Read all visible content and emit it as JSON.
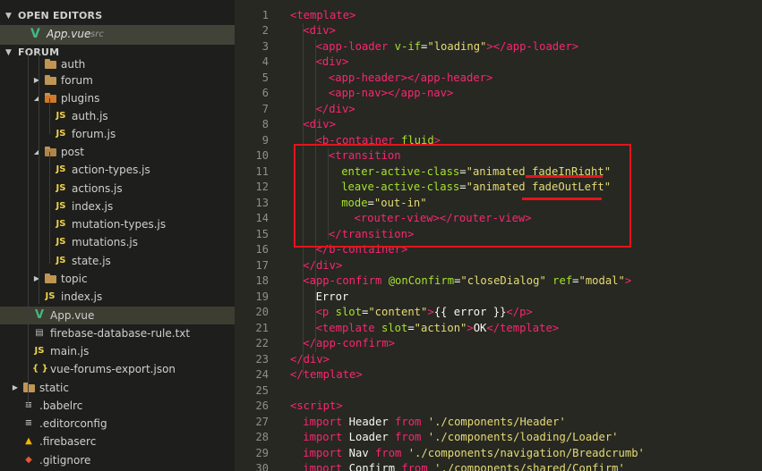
{
  "sidebar": {
    "open_editors_header": "OPEN EDITORS",
    "open_editor": {
      "name": "App.vue",
      "desc": "src"
    },
    "project_header": "FORUM",
    "tree": [
      {
        "label": "auth",
        "type": "folder"
      },
      {
        "label": "forum",
        "type": "folder"
      },
      {
        "label": "plugins",
        "type": "folder"
      },
      {
        "label": "auth.js",
        "type": "js"
      },
      {
        "label": "forum.js",
        "type": "js"
      },
      {
        "label": "post",
        "type": "folder"
      },
      {
        "label": "action-types.js",
        "type": "js"
      },
      {
        "label": "actions.js",
        "type": "js"
      },
      {
        "label": "index.js",
        "type": "js"
      },
      {
        "label": "mutation-types.js",
        "type": "js"
      },
      {
        "label": "mutations.js",
        "type": "js"
      },
      {
        "label": "state.js",
        "type": "js"
      },
      {
        "label": "topic",
        "type": "folder"
      },
      {
        "label": "index.js",
        "type": "js"
      },
      {
        "label": "App.vue",
        "type": "vue"
      },
      {
        "label": "firebase-database-rule.txt",
        "type": "txt"
      },
      {
        "label": "main.js",
        "type": "js"
      },
      {
        "label": "vue-forums-export.json",
        "type": "json"
      },
      {
        "label": "static",
        "type": "folder"
      },
      {
        "label": ".babelrc",
        "type": "cfg"
      },
      {
        "label": ".editorconfig",
        "type": "cfg"
      },
      {
        "label": ".firebaserc",
        "type": "firebase"
      },
      {
        "label": ".gitignore",
        "type": "git"
      }
    ],
    "icons": {
      "js": "JS",
      "json": "{ }",
      "vue": "V"
    }
  },
  "editor": {
    "line_numbers": [
      "1",
      "2",
      "3",
      "4",
      "5",
      "6",
      "7",
      "8",
      "9",
      "10",
      "11",
      "12",
      "13",
      "14",
      "15",
      "16",
      "17",
      "18",
      "19",
      "20",
      "21",
      "22",
      "23",
      "24",
      "25",
      "26",
      "27",
      "28",
      "29",
      "30"
    ],
    "lines": [
      [
        [
          "tag",
          "<template>"
        ]
      ],
      [
        [
          "tag",
          "<div>"
        ]
      ],
      [
        [
          "tag",
          "<app-loader "
        ],
        [
          "attr",
          "v-if"
        ],
        [
          "txt",
          "="
        ],
        [
          "str",
          "\"loading\""
        ],
        [
          "tag",
          "></app-loader>"
        ]
      ],
      [
        [
          "tag",
          "<div>"
        ]
      ],
      [
        [
          "tag",
          "<app-header></app-header>"
        ]
      ],
      [
        [
          "tag",
          "<app-nav></app-nav>"
        ]
      ],
      [
        [
          "tag",
          "</div>"
        ]
      ],
      [
        [
          "tag",
          "<div>"
        ]
      ],
      [
        [
          "tag",
          "<b-container "
        ],
        [
          "attr",
          "fluid"
        ],
        [
          "tag",
          ">"
        ]
      ],
      [
        [
          "tag",
          "<transition"
        ]
      ],
      [
        [
          "attr",
          "enter-active-class"
        ],
        [
          "txt",
          "="
        ],
        [
          "str",
          "\"animated fadeInRight\""
        ]
      ],
      [
        [
          "attr",
          "leave-active-class"
        ],
        [
          "txt",
          "="
        ],
        [
          "str",
          "\"animated fadeOutLeft\""
        ]
      ],
      [
        [
          "attr",
          "mode"
        ],
        [
          "txt",
          "="
        ],
        [
          "str",
          "\"out-in\""
        ]
      ],
      [
        [
          "tag",
          "<router-view></router-view>"
        ]
      ],
      [
        [
          "tag",
          "</transition>"
        ]
      ],
      [
        [
          "tag",
          "</b-container>"
        ]
      ],
      [
        [
          "tag",
          "</div>"
        ]
      ],
      [
        [
          "tag",
          "<app-confirm "
        ],
        [
          "attr",
          "@onConfirm"
        ],
        [
          "txt",
          "="
        ],
        [
          "str",
          "\"closeDialog\""
        ],
        [
          "txt",
          " "
        ],
        [
          "attr",
          "ref"
        ],
        [
          "txt",
          "="
        ],
        [
          "str",
          "\"modal\""
        ],
        [
          "tag",
          ">"
        ]
      ],
      [
        [
          "txt",
          "Error"
        ]
      ],
      [
        [
          "tag",
          "<p "
        ],
        [
          "attr",
          "slot"
        ],
        [
          "txt",
          "="
        ],
        [
          "str",
          "\"content\""
        ],
        [
          "tag",
          ">"
        ],
        [
          "txt",
          "{{ error }}"
        ],
        [
          "tag",
          "</p>"
        ]
      ],
      [
        [
          "tag",
          "<template "
        ],
        [
          "attr",
          "slot"
        ],
        [
          "txt",
          "="
        ],
        [
          "str",
          "\"action\""
        ],
        [
          "tag",
          ">"
        ],
        [
          "txt",
          "OK"
        ],
        [
          "tag",
          "</template>"
        ]
      ],
      [
        [
          "tag",
          "</app-confirm>"
        ]
      ],
      [
        [
          "tag",
          "</div>"
        ]
      ],
      [
        [
          "tag",
          "</template>"
        ]
      ],
      [],
      [
        [
          "tag",
          "<script>"
        ]
      ],
      [
        [
          "kw",
          "import "
        ],
        [
          "txt",
          "Header "
        ],
        [
          "kw",
          "from "
        ],
        [
          "str",
          "'./components/Header'"
        ]
      ],
      [
        [
          "kw",
          "import "
        ],
        [
          "txt",
          "Loader "
        ],
        [
          "kw",
          "from "
        ],
        [
          "str",
          "'./components/loading/Loader'"
        ]
      ],
      [
        [
          "kw",
          "import "
        ],
        [
          "txt",
          "Nav "
        ],
        [
          "kw",
          "from "
        ],
        [
          "str",
          "'./components/navigation/Breadcrumb'"
        ]
      ],
      [
        [
          "kw",
          "import "
        ],
        [
          "txt",
          "Confirm "
        ],
        [
          "kw",
          "from "
        ],
        [
          "str",
          "'./components/shared/Confirm'"
        ]
      ]
    ]
  },
  "colors": {
    "highlight_box": "#e4141b"
  }
}
